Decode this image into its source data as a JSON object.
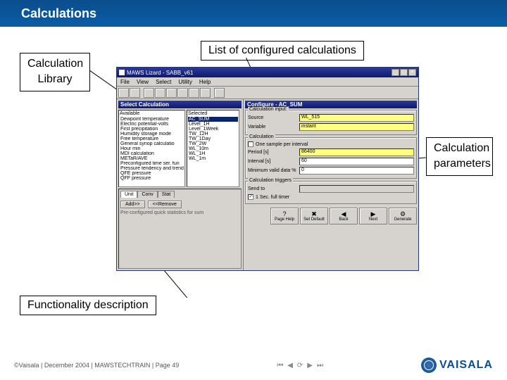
{
  "slide": {
    "title": "Calculations"
  },
  "annotations": {
    "library": "Calculation\nLibrary",
    "configured": "List of configured calculations",
    "params": "Calculation\nparameters",
    "funcdesc": "Functionality description"
  },
  "window": {
    "title": "MAWS Lizard - SABB_v61",
    "menu": [
      "File",
      "View",
      "Select",
      "Utility",
      "Help"
    ],
    "left_pane_title": "Select Calculation",
    "right_pane_title": "Configure - AC_SUM",
    "available_label": "Available",
    "selected_label": "Selected",
    "available": [
      "Dewpoint temperature",
      "Electric potential-volts",
      "First precipitation",
      "Humidity storage mode",
      "Free temperature",
      "General synop calculatio",
      "Hour min",
      "MDI calculation",
      "METaR/AVE",
      "Preconfigured time ser. fun",
      "Pressure tendency and trend",
      "QFE pressure",
      "QFF pressure"
    ],
    "selected": [
      "AC_SUM",
      "Level_1H",
      "Level_1Week",
      "TW_12H",
      "TW_1Day",
      "TW_2W",
      "WL_10m",
      "WL_1H",
      "WL_1m"
    ],
    "tabs": [
      "Unit",
      "Conv",
      "Stat"
    ],
    "add_label": "Add>>",
    "remove_label": "<<Remove",
    "desc_text": "Pre-configured quick statistics for sum",
    "groups": {
      "input": {
        "title": "Calculation input:",
        "source_label": "Source",
        "source_value": "WL_515",
        "variable_label": "Variable",
        "variable_value": "instant"
      },
      "calc": {
        "title": "Calculation",
        "one_sample_label": "One sample per interval",
        "period_label": "Period [s]",
        "period_value": "86400",
        "interval_label": "Interval [s]",
        "interval_value": "60",
        "minvalid_label": "Minimum valid data %",
        "minvalid_value": "0"
      },
      "triggers": {
        "title": "Calculation triggers",
        "sendto_label": "Send to",
        "timer_label": "1 Sec. full timer",
        "timer_checked": "✓"
      }
    },
    "nav": [
      {
        "icon": "?",
        "label": "Page Help"
      },
      {
        "icon": "✖",
        "label": "Set Default"
      },
      {
        "icon": "◀",
        "label": "Back"
      },
      {
        "icon": "▶",
        "label": "Next"
      },
      {
        "icon": "⚙",
        "label": "Generate"
      }
    ]
  },
  "footer": {
    "text": "©Vaisala | December 2004 | MAWSTECHTRAIN | Page 49",
    "logo": "VAISALA"
  }
}
